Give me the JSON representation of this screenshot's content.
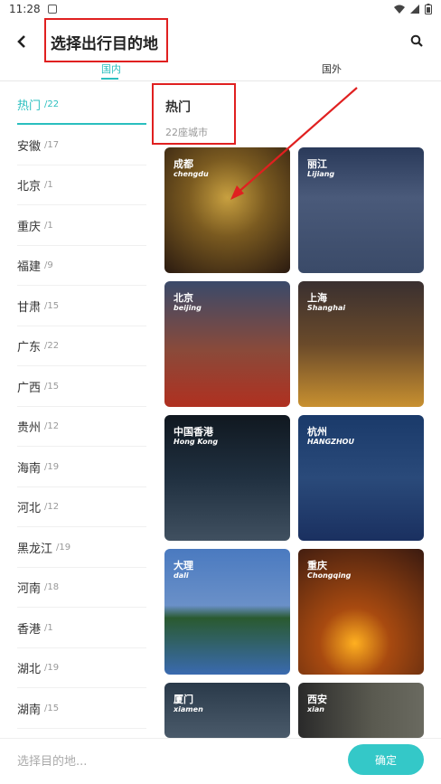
{
  "status_bar": {
    "time": "11:28"
  },
  "header": {
    "title": "选择出行目的地"
  },
  "tabs": [
    {
      "label": "国内"
    },
    {
      "label": "国外"
    }
  ],
  "sidebar": {
    "items": [
      {
        "name": "热门",
        "count": "/22"
      },
      {
        "name": "安徽",
        "count": "/17"
      },
      {
        "name": "北京",
        "count": "/1"
      },
      {
        "name": "重庆",
        "count": "/1"
      },
      {
        "name": "福建",
        "count": "/9"
      },
      {
        "name": "甘肃",
        "count": "/15"
      },
      {
        "name": "广东",
        "count": "/22"
      },
      {
        "name": "广西",
        "count": "/15"
      },
      {
        "name": "贵州",
        "count": "/12"
      },
      {
        "name": "海南",
        "count": "/19"
      },
      {
        "name": "河北",
        "count": "/12"
      },
      {
        "name": "黑龙江",
        "count": "/19"
      },
      {
        "name": "河南",
        "count": "/18"
      },
      {
        "name": "香港",
        "count": "/1"
      },
      {
        "name": "湖北",
        "count": "/19"
      },
      {
        "name": "湖南",
        "count": "/15"
      }
    ]
  },
  "section": {
    "title": "热门",
    "subtitle": "22座城市"
  },
  "cities": [
    {
      "cn": "成都",
      "en": "chengdu"
    },
    {
      "cn": "丽江",
      "en": "Lijiang"
    },
    {
      "cn": "北京",
      "en": "beijing"
    },
    {
      "cn": "上海",
      "en": "Shanghai"
    },
    {
      "cn": "中国香港",
      "en": "Hong Kong"
    },
    {
      "cn": "杭州",
      "en": "HANGZHOU"
    },
    {
      "cn": "大理",
      "en": "dali"
    },
    {
      "cn": "重庆",
      "en": "Chongqing"
    },
    {
      "cn": "厦门",
      "en": "xiamen"
    },
    {
      "cn": "西安",
      "en": "xian"
    }
  ],
  "bottom": {
    "placeholder": "选择目的地...",
    "confirm_label": "确定"
  },
  "colors": {
    "accent": "#2abfbf",
    "button": "#34c8c8",
    "annotation": "#e02020"
  }
}
